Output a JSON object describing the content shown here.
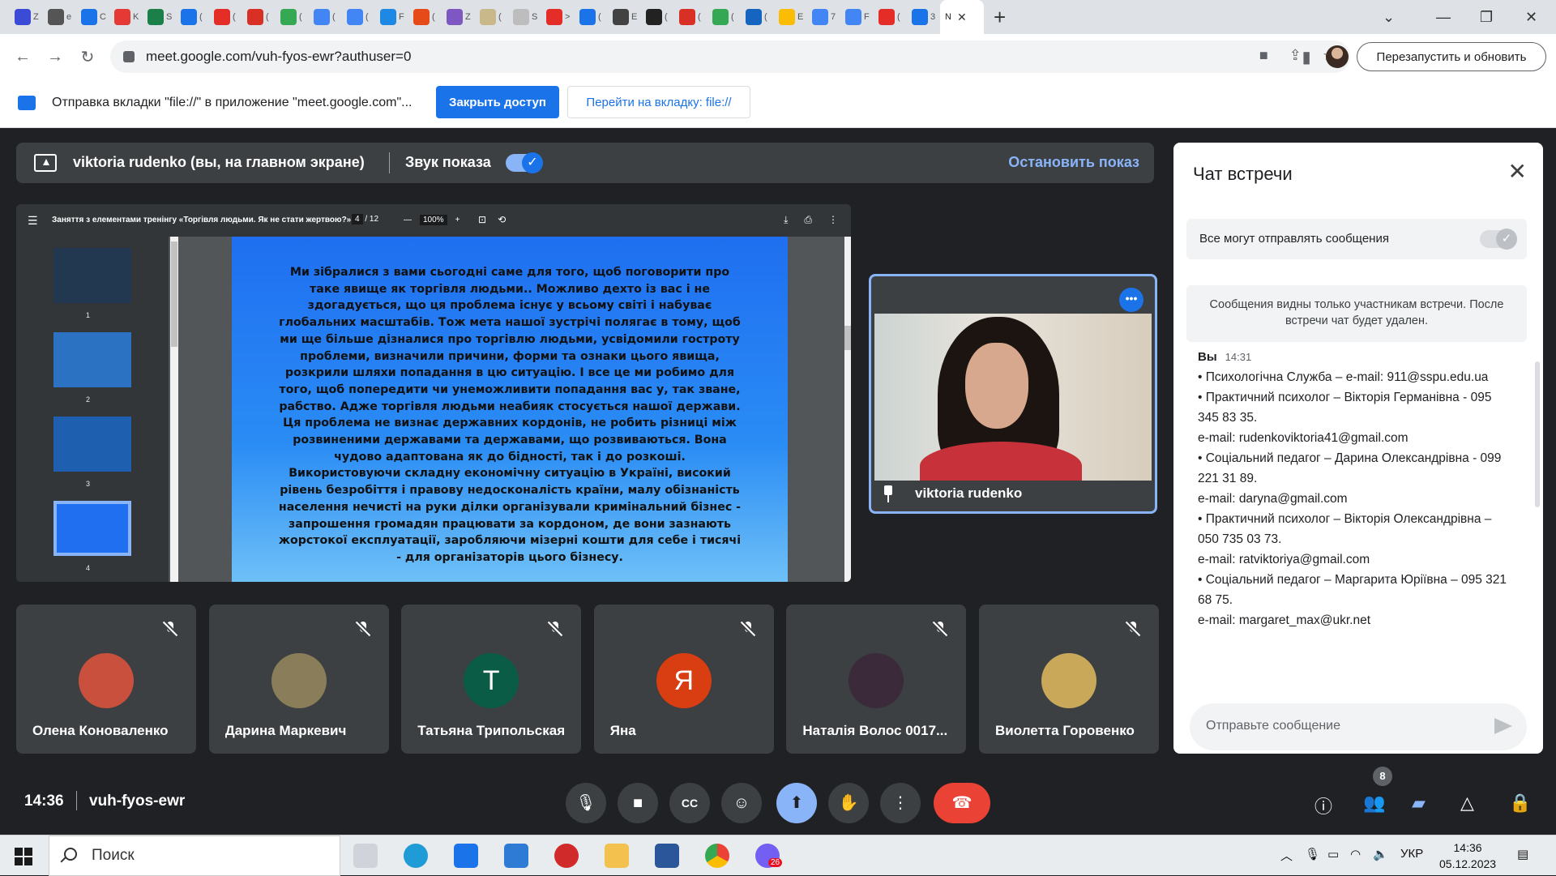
{
  "browser": {
    "url": "meet.google.com/vuh-fyos-ewr?authuser=0",
    "relaunch_label": "Перезапустить и обновить",
    "tabs": [
      {
        "letter": "Z",
        "color": "#3b4bd6"
      },
      {
        "letter": "e",
        "color": "#555555"
      },
      {
        "letter": "C",
        "color": "#1a73e8"
      },
      {
        "letter": "K",
        "color": "#e53935"
      },
      {
        "letter": "S",
        "color": "#1b7f4a"
      },
      {
        "letter": "(",
        "color": "#1a73e8"
      },
      {
        "letter": "(",
        "color": "#e52d27"
      },
      {
        "letter": "(",
        "color": "#d93025"
      },
      {
        "letter": "(",
        "color": "#34a853"
      },
      {
        "letter": "(",
        "color": "#4285f4"
      },
      {
        "letter": "(",
        "color": "#4285f4"
      },
      {
        "letter": "F",
        "color": "#1e88e5"
      },
      {
        "letter": "(",
        "color": "#e64a19"
      },
      {
        "letter": "Z",
        "color": "#7e57c2"
      },
      {
        "letter": "(",
        "color": "#c8b88a"
      },
      {
        "letter": "S",
        "color": "#bdbdbd"
      },
      {
        "letter": ">",
        "color": "#e52d27"
      },
      {
        "letter": "(",
        "color": "#1a73e8"
      },
      {
        "letter": "E",
        "color": "#424242"
      },
      {
        "letter": "(",
        "color": "#222222"
      },
      {
        "letter": "(",
        "color": "#d93025"
      },
      {
        "letter": "(",
        "color": "#34a853"
      },
      {
        "letter": "(",
        "color": "#1565c0"
      },
      {
        "letter": "E",
        "color": "#fbbc04"
      },
      {
        "letter": "7",
        "color": "#4285f4"
      },
      {
        "letter": "F",
        "color": "#4285f4"
      },
      {
        "letter": "(",
        "color": "#e52d27"
      },
      {
        "letter": "3",
        "color": "#1a73e8"
      }
    ],
    "active_tab_letter": "N"
  },
  "infobar": {
    "text": "Отправка вкладки \"file://\" в приложение \"meet.google.com\"...",
    "stop_access": "Закрыть доступ",
    "go_to_tab": "Перейти на вкладку: file://"
  },
  "presenting": {
    "who": "viktoria rudenko (вы, на главном экране)",
    "sound": "Звук показа",
    "stop": "Остановить показ"
  },
  "pdf": {
    "title": "Заняття з елементами тренінгу «Торгівля людьми. Як не стати жертвою?»",
    "page_current": "4",
    "page_total": "/ 12",
    "zoom": "100%",
    "thumb_numbers": [
      "1",
      "2",
      "3",
      "4"
    ],
    "page_text": "Ми зібралися з вами сьогодні саме для того, щоб поговорити про таке  явище як торгівля людьми.. Можливо дехто із вас і не здогадується, що ця проблема існує у всьому світі і набуває глобальних масштабів. Тож мета нашої зустрічі полягає в тому, щоб ми ще більше дізналися про торгівлю людьми, усвідомили гостроту проблеми, визначили причини, форми та ознаки цього явища, розкрили шляхи попадання в цю ситуацію. І все це ми робимо для того, щоб попередити чи унеможливити попадання вас у, так зване, рабство. Адже торгівля людьми неабияк стосується нашої держави. Ця проблема не визнає державних кордонів, не робить різниці між розвиненими державами та державами, що розвиваються. Вона чудово адаптована як до бідності, так і до розкоші. Використовуючи складну економічну ситуацію в Україні, високий рівень безробіття і правову недосконалість країни, малу обізнаність населення нечисті на руки ділки організували кримінальний бізнес - запрошення громадян працювати за кордоном, де вони зазнають жорстокої експлуатації, заробляючи мізерні кошти для себе і тисячі - для організаторів цього бізнесу."
  },
  "self_tile": {
    "name": "viktoria rudenko"
  },
  "participants": [
    {
      "name": "Олена Коноваленко",
      "initial": "",
      "color": "#c8503c"
    },
    {
      "name": "Дарина Маркевич",
      "initial": "",
      "color": "#8a7d5a"
    },
    {
      "name": "Татьяна Трипольская",
      "initial": "T",
      "color": "#0b5c46"
    },
    {
      "name": "Яна",
      "initial": "Я",
      "color": "#d93d12"
    },
    {
      "name": "Наталія Волос 0017...",
      "initial": "",
      "color": "#3b2a3a"
    },
    {
      "name": "Виолетта Горовенко",
      "initial": "",
      "color": "#c9a85a"
    }
  ],
  "chat": {
    "title": "Чат встречи",
    "permission": "Все могут отправлять сообщения",
    "notice": "Сообщения видны только участникам встречи. После встречи чат будет удален.",
    "sender": "Вы",
    "time": "14:31",
    "lines": [
      "•      Психологічна Служба – e-mail: 911@sspu.edu.ua",
      "•      Практичний психолог – Вікторія Германівна - 095 345 83 35.",
      "e-mail: rudenkoviktoria41@gmail.com",
      "•      Соціальний педагог – Дарина Олександрівна - 099 221 31 89.",
      "e-mail: daryna@gmail.com",
      "•      Практичний психолог – Вікторія Олександрівна – 050 735 03 73.",
      "e-mail: ratviktoriya@gmail.com",
      "•      Соціальний педагог – Маргарита Юріївна – 095 321 68 75.",
      "e-mail: margaret_max@ukr.net"
    ],
    "input_placeholder": "Отправьте сообщение"
  },
  "controls": {
    "clock": "14:36",
    "meeting_code": "vuh-fyos-ewr",
    "participants_count": "8"
  },
  "taskbar": {
    "search": "Поиск",
    "lang": "УКР",
    "time": "14:36",
    "date": "05.12.2023",
    "viber_badge": "26"
  }
}
